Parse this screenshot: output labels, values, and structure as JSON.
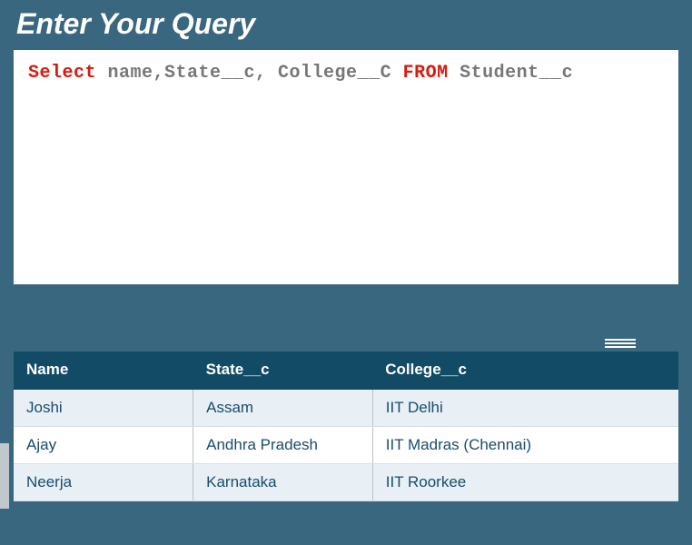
{
  "header": {
    "title": "Enter Your Query"
  },
  "query": {
    "tokens": [
      {
        "text": "Select",
        "kw": true
      },
      {
        "text": " name,State__c, College__C ",
        "kw": false
      },
      {
        "text": "FROM",
        "kw": true
      },
      {
        "text": " Student__c",
        "kw": false
      }
    ]
  },
  "results": {
    "columns": [
      "Name",
      "State__c",
      "College__c"
    ],
    "rows": [
      [
        "Joshi",
        "Assam",
        "IIT Delhi"
      ],
      [
        "Ajay",
        "Andhra Pradesh",
        "IIT Madras (Chennai)"
      ],
      [
        "Neerja",
        "Karnataka",
        "IIT Roorkee"
      ]
    ]
  }
}
